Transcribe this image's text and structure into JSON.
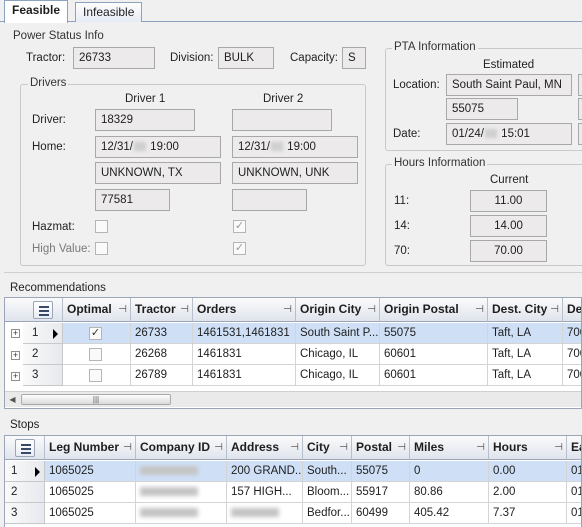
{
  "tabs": [
    {
      "label": "Feasible",
      "active": true
    },
    {
      "label": "Infeasible",
      "active": false
    }
  ],
  "power_status": {
    "title": "Power Status Info",
    "tractor_label": "Tractor:",
    "tractor_value": "26733",
    "division_label": "Division:",
    "division_value": "BULK",
    "capacity_label": "Capacity:",
    "capacity_value": "S"
  },
  "drivers": {
    "title": "Drivers",
    "driver1_header": "Driver 1",
    "driver2_header": "Driver 2",
    "driver_label": "Driver:",
    "home_label": "Home:",
    "hazmat_label": "Hazmat:",
    "high_value_label": "High Value:",
    "d1_driver": "18329",
    "d1_home_date_a": "12/31/",
    "d1_home_date_b": " 19:00",
    "d1_city": "UNKNOWN, TX",
    "d1_zip": "77581",
    "d2_driver": "",
    "d2_home_date_a": "12/31/",
    "d2_home_date_b": " 19:00",
    "d2_city": "UNKNOWN, UNK",
    "d2_zip": "",
    "d1_hazmat": false,
    "d2_hazmat": true,
    "d1_high_value": false,
    "d2_high_value": true
  },
  "pta": {
    "title": "PTA Information",
    "estimated_header": "Estimated",
    "location_label": "Location:",
    "location_value": "South Saint Paul, MN",
    "zip_value": "55075",
    "date_label": "Date:",
    "date_a": "01/24/",
    "date_b": " 15:01"
  },
  "hours": {
    "title": "Hours Information",
    "current_header": "Current",
    "h11_label": "11:",
    "h11_value": "11.00",
    "h14_label": "14:",
    "h14_value": "14.00",
    "h70_label": "70:",
    "h70_value": "70.00"
  },
  "recommendations": {
    "title": "Recommendations",
    "pin_glyph": "⊣",
    "columns": [
      "Optimal",
      "Tractor",
      "Orders",
      "Origin City",
      "Origin Postal",
      "Dest. City",
      "De"
    ],
    "rows": [
      {
        "num": "1",
        "optimal": true,
        "tractor": "26733",
        "orders": "1461531,1461831",
        "origin_city": "South Saint P...",
        "origin_postal": "55075",
        "dest_city": "Taft, LA",
        "de": "700"
      },
      {
        "num": "2",
        "optimal": false,
        "tractor": "26268",
        "orders": "1461831",
        "origin_city": "Chicago, IL",
        "origin_postal": "60601",
        "dest_city": "Taft, LA",
        "de": "700"
      },
      {
        "num": "3",
        "optimal": false,
        "tractor": "26789",
        "orders": "1461831",
        "origin_city": "Chicago, IL",
        "origin_postal": "60601",
        "dest_city": "Taft, LA",
        "de": "700"
      }
    ],
    "scroll_thumb": "|||"
  },
  "stops": {
    "title": "Stops",
    "columns": [
      "Leg Number",
      "Company ID",
      "Address",
      "City",
      "Postal",
      "Miles",
      "Hours",
      "Ea"
    ],
    "rows": [
      {
        "num": "1",
        "leg": "1065025",
        "address": "200 GRAND...",
        "city": "South...",
        "postal": "55075",
        "miles": "0",
        "hours": "0.00",
        "ea": "01/"
      },
      {
        "num": "2",
        "leg": "1065025",
        "address": "157 HIGH...",
        "city": "Bloom...",
        "postal": "55917",
        "miles": "80.86",
        "hours": "2.00",
        "ea": "01/"
      },
      {
        "num": "3",
        "leg": "1065025",
        "address": "",
        "city": "Bedfor...",
        "postal": "60499",
        "miles": "405.42",
        "hours": "7.37",
        "ea": "01/"
      }
    ]
  }
}
